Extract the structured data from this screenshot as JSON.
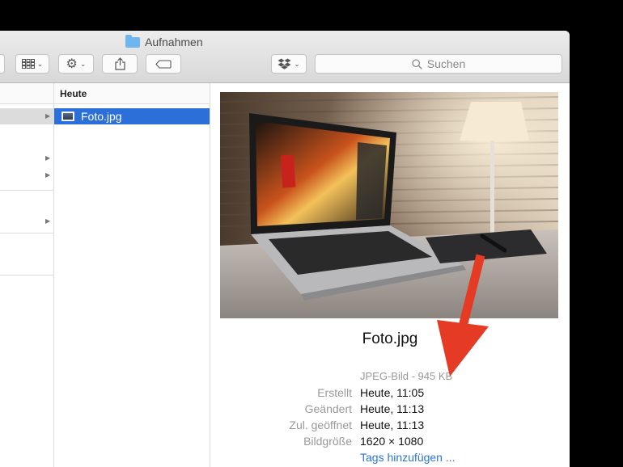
{
  "window": {
    "title": "Aufnahmen",
    "toolbar": {
      "view_label": "View options",
      "action_label": "Action",
      "share_label": "Share",
      "tags_label": "Tags",
      "dropbox_label": "Dropbox",
      "search_placeholder": "Suchen"
    }
  },
  "columns": {
    "column2_header": "Heute",
    "selected_file": "Foto.jpg"
  },
  "preview": {
    "filename": "Foto.jpg",
    "kind": "JPEG-Bild - 945 KB",
    "meta": [
      {
        "key": "Erstellt",
        "value": "Heute, 11:05"
      },
      {
        "key": "Geändert",
        "value": "Heute, 11:13"
      },
      {
        "key": "Zul. geöffnet",
        "value": "Heute, 11:13"
      },
      {
        "key": "Bildgröße",
        "value": "1620 × 1080"
      }
    ],
    "add_tags": "Tags hinzufügen ..."
  },
  "colors": {
    "selection": "#2d6fd8",
    "link": "#2a74d8",
    "annotation_arrow": "#e53a23"
  },
  "icons": [
    "folder-icon",
    "column-view-icon",
    "gear-icon",
    "share-icon",
    "tag-icon",
    "dropbox-icon",
    "search-icon",
    "image-file-icon"
  ]
}
